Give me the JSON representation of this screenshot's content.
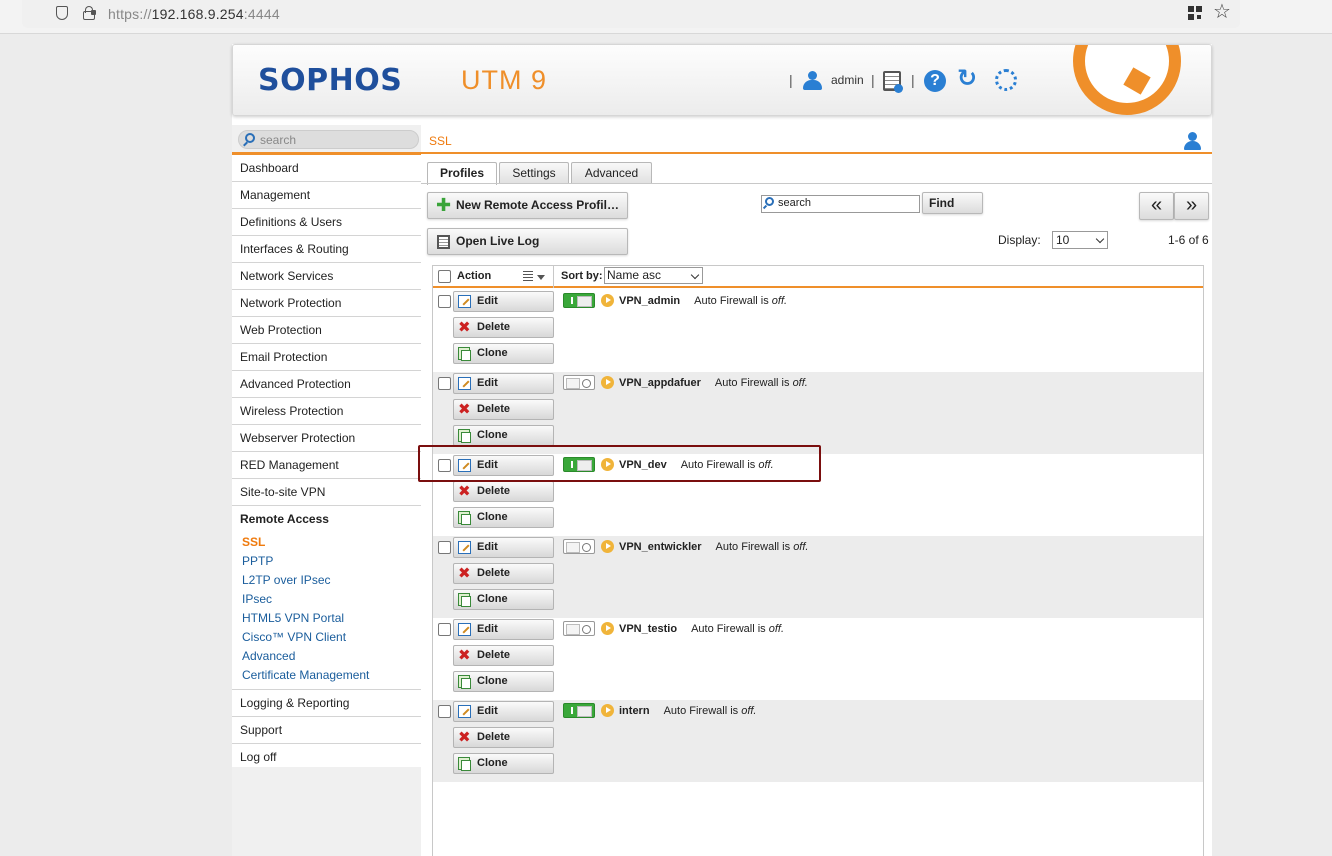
{
  "browser": {
    "url_scheme": "https://",
    "url_host": "192.168.9.254",
    "url_port": ":4444"
  },
  "header": {
    "logo": "SOPHOS",
    "product": "UTM 9",
    "user": "admin",
    "separators": [
      "|",
      "|",
      "|"
    ]
  },
  "sidebar": {
    "search_placeholder": "search",
    "items": [
      "Dashboard",
      "Management",
      "Definitions & Users",
      "Interfaces & Routing",
      "Network Services",
      "Network Protection",
      "Web Protection",
      "Email Protection",
      "Advanced Protection",
      "Wireless Protection",
      "Webserver Protection",
      "RED Management",
      "Site-to-site VPN"
    ],
    "section": "Remote Access",
    "sub_items": [
      "SSL",
      "PPTP",
      "L2TP over IPsec",
      "IPsec",
      "HTML5 VPN Portal",
      "Cisco™ VPN Client",
      "Advanced",
      "Certificate Management"
    ],
    "bottom_items": [
      "Logging & Reporting",
      "Support",
      "Log off"
    ]
  },
  "content": {
    "breadcrumb": "SSL",
    "tabs": [
      "Profiles",
      "Settings",
      "Advanced"
    ],
    "new_button": "New Remote Access Profil…",
    "log_button": "Open Live Log",
    "search_placeholder": "search",
    "find_button": "Find",
    "pager_prev": "«",
    "pager_next": "»",
    "display_label": "Display:",
    "display_value": "10",
    "pager_info": "1-6 of 6",
    "col_action": "Action",
    "sort_label": "Sort by:",
    "sort_value": "Name asc"
  },
  "row_buttons": {
    "edit": "Edit",
    "delete": "Delete",
    "clone": "Clone"
  },
  "firewall_prefix": "Auto Firewall is",
  "firewall_state": "off.",
  "profiles": [
    {
      "name": "VPN_admin",
      "enabled": true
    },
    {
      "name": "VPN_appdafuer",
      "enabled": false
    },
    {
      "name": "VPN_dev",
      "enabled": true
    },
    {
      "name": "VPN_entwickler",
      "enabled": false
    },
    {
      "name": "VPN_testio",
      "enabled": false
    },
    {
      "name": "intern",
      "enabled": true
    }
  ],
  "colors": {
    "accent": "#ef8f2a",
    "brand_blue": "#1f4f9c",
    "link_blue": "#1a5d9c",
    "toggle_on": "#3aa83a",
    "highlight_box": "#7a0e0e"
  }
}
